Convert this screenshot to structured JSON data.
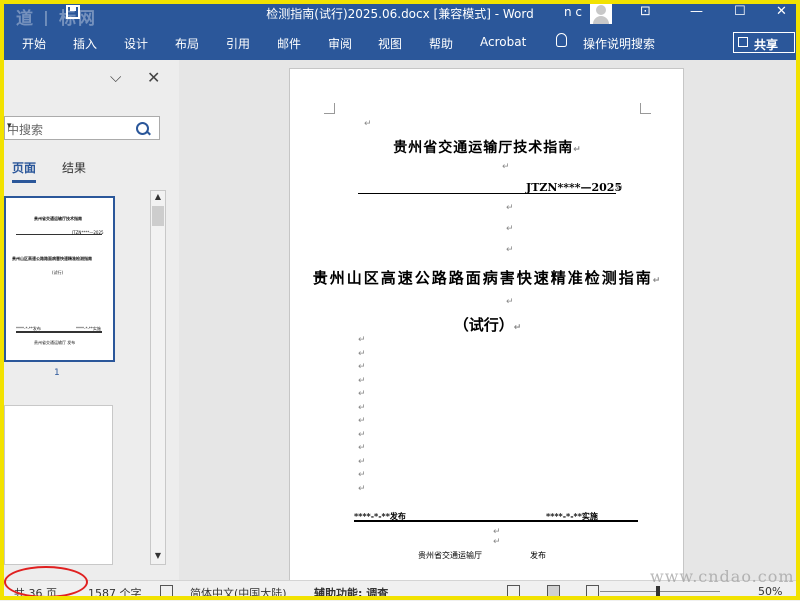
{
  "title_bar": {
    "watermark": "道 | 标网",
    "document_title": "检测指南(试行)2025.06.docx [兼容模式] - Word",
    "user_initials": "n c"
  },
  "ribbon": {
    "tabs": [
      "开始",
      "插入",
      "设计",
      "布局",
      "引用",
      "邮件",
      "审阅",
      "视图",
      "帮助",
      "Acrobat"
    ],
    "tell_me": "操作说明搜索",
    "share": "共享"
  },
  "nav_pane": {
    "search_placeholder": "中搜索",
    "tabs": [
      "页面",
      "结果"
    ],
    "active_tab": "页面",
    "current_page_marker": "1",
    "thumb_text": {
      "line1": "贵州省交通运输厅技术指南",
      "code": "JTZN****—2025",
      "title": "贵州山区高速公路路面病害快速精准检测指南",
      "trial": "(试行)",
      "pub_left": "****-*-**发布",
      "pub_right": "****-*-**实施",
      "issuer": "贵州省交通运输厅 发布"
    }
  },
  "document": {
    "header": "贵州省交通运输厅技术指南",
    "code": "JTZN****—2025",
    "title": "贵州山区高速公路路面病害快速精准检测指南",
    "subtitle": "（试行）",
    "publish_date": "****-*-**发布",
    "implement_date": "****-*-**实施",
    "issuer": "贵州省交通运输厅",
    "issued": "发布",
    "paragraph_mark": "↵"
  },
  "status_bar": {
    "pages": "共 36 页",
    "words": "1587 个字",
    "language": "简体中文(中国大陆)",
    "accessibility": "辅助功能: 调查",
    "zoom": "50%"
  },
  "watermark_site": "www.cndao.com",
  "colors": {
    "ribbon": "#2b579a",
    "frame": "#f2e200",
    "annotation": "#e02020"
  }
}
